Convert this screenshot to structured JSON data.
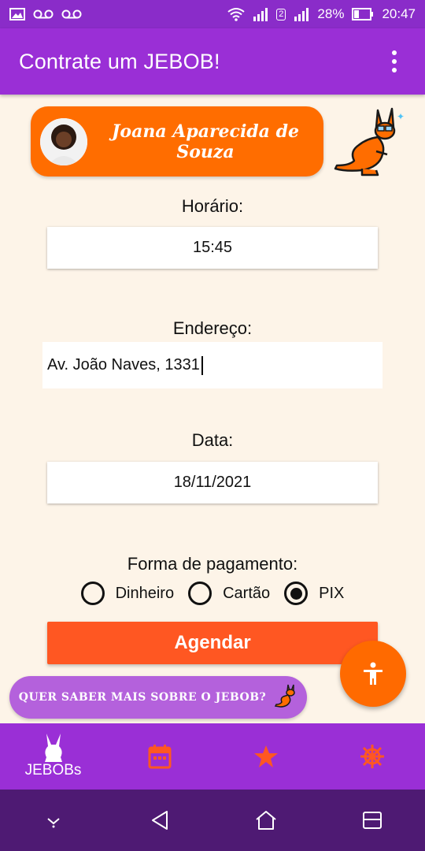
{
  "status_bar": {
    "battery": "28%",
    "time": "20:47",
    "sim_slot": "2",
    "icons": [
      "image-icon",
      "voicemail-icon",
      "voicemail-icon",
      "wifi-icon",
      "signal-icon",
      "signal-icon",
      "battery-icon"
    ]
  },
  "app_bar": {
    "title": "Contrate um JEBOB!"
  },
  "profile": {
    "name": "Joana Aparecida de Souza"
  },
  "form": {
    "time_label": "Horário:",
    "time_value": "15:45",
    "address_label": "Endereço:",
    "address_value": "Av. João Naves, 1331",
    "date_label": "Data:",
    "date_value": "18/11/2021",
    "payment_label": "Forma de pagamento:",
    "payment_options": [
      {
        "label": "Dinheiro",
        "selected": false
      },
      {
        "label": "Cartão",
        "selected": false
      },
      {
        "label": "PIX",
        "selected": true
      }
    ],
    "submit_label": "Agendar"
  },
  "info_banner": {
    "text": "QUER SABER MAIS SOBRE O JEBOB?"
  },
  "bottom_nav": [
    {
      "label": "JEBOBs",
      "icon": "kangaroo-icon",
      "active": true
    },
    {
      "label": "",
      "icon": "calendar-icon",
      "active": false
    },
    {
      "label": "",
      "icon": "star-icon",
      "active": false
    },
    {
      "label": "",
      "icon": "ship-wheel-icon",
      "active": false
    }
  ],
  "colors": {
    "primary": "#9a2fd6",
    "accent": "#ff6d00",
    "button": "#ff5722",
    "background": "#fdf4e8",
    "banner": "#b461dc",
    "system_nav": "#4e1a73"
  }
}
